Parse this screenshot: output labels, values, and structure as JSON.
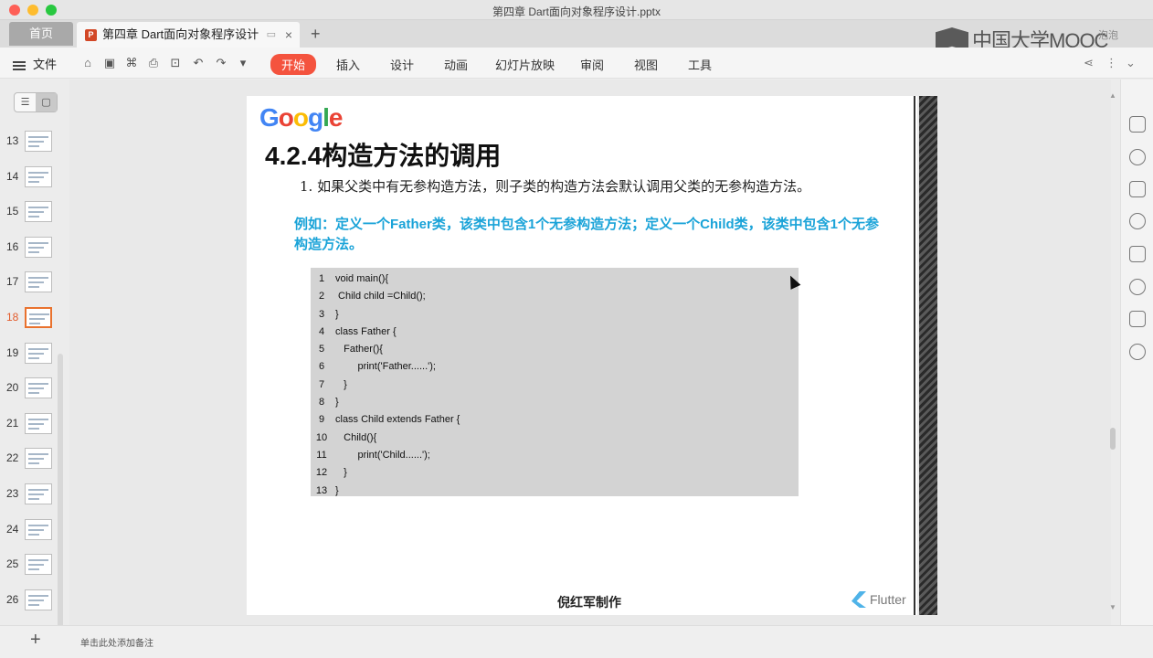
{
  "window": {
    "title": "第四章 Dart面向对象程序设计.pptx"
  },
  "tabs": {
    "home_label": "首页",
    "doc_label": "第四章 Dart面向对象程序设计",
    "close_glyph": "×",
    "add_glyph": "+"
  },
  "brand": {
    "mooc_text": "中国大学MOOC",
    "user_name": "泡泡"
  },
  "menu": {
    "file_label": "文件",
    "tabs": [
      "开始",
      "插入",
      "设计",
      "动画",
      "幻灯片放映",
      "审阅",
      "视图",
      "工具"
    ],
    "active_tab": "开始"
  },
  "thumbnails": {
    "numbers": [
      "13",
      "14",
      "15",
      "16",
      "17",
      "18",
      "19",
      "20",
      "21",
      "22",
      "23",
      "24",
      "25",
      "26"
    ],
    "active": "18"
  },
  "slide": {
    "logo_letters": [
      "G",
      "o",
      "o",
      "g",
      "l",
      "e"
    ],
    "title": "4.2.4构造方法的调用",
    "point": "1. 如果父类中有无参构造方法，则子类的构造方法会默认调用父类的无参构造方法。",
    "example": "例如：定义一个Father类，该类中包含1个无参构造方法；定义一个Child类，该类中包含1个无参构造方法。",
    "code_lines": [
      {
        "n": "1",
        "code": "void main(){"
      },
      {
        "n": "2",
        "code": " Child child =Child();"
      },
      {
        "n": "3",
        "code": "}"
      },
      {
        "n": "4",
        "code": "class Father {"
      },
      {
        "n": "5",
        "code": "   Father(){"
      },
      {
        "n": "6",
        "code": "        print('Father......');"
      },
      {
        "n": "7",
        "code": "   }"
      },
      {
        "n": "8",
        "code": "}"
      },
      {
        "n": "9",
        "code": "class Child extends Father {"
      },
      {
        "n": "10",
        "code": "   Child(){"
      },
      {
        "n": "11",
        "code": "        print('Child......');"
      },
      {
        "n": "12",
        "code": "   }"
      },
      {
        "n": "13",
        "code": "}"
      }
    ],
    "footer": "倪红军制作",
    "flutter_text": "Flutter"
  },
  "bottom": {
    "add_glyph": "+",
    "notes_placeholder": "单击此处添加备注"
  },
  "colors": {
    "accent": "#f4533e",
    "example_text": "#1aa3d8",
    "active_thumb": "#e9722e"
  }
}
